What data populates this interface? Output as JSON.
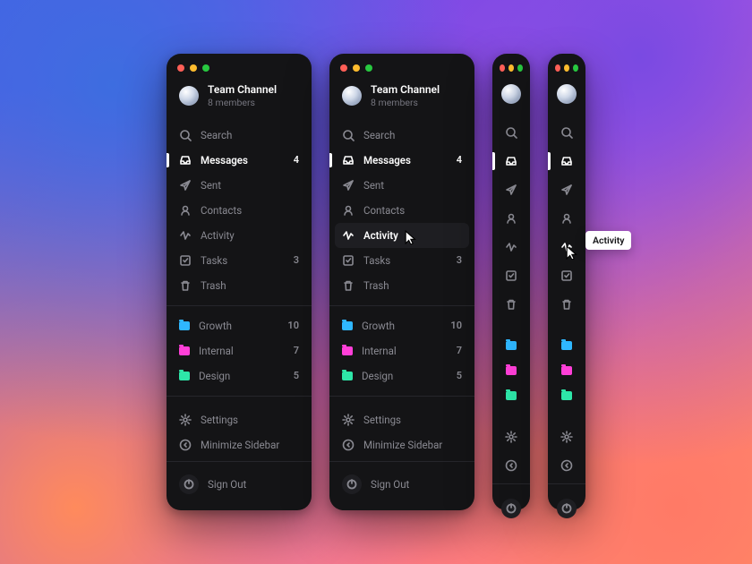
{
  "header": {
    "team_name": "Team Channel",
    "members": "8 members"
  },
  "nav": {
    "search": "Search",
    "messages": {
      "label": "Messages",
      "count": "4"
    },
    "sent": "Sent",
    "contacts": "Contacts",
    "activity": "Activity",
    "tasks": {
      "label": "Tasks",
      "count": "3"
    },
    "trash": "Trash"
  },
  "folders": {
    "growth": {
      "label": "Growth",
      "count": "10",
      "color": "#2fb7ff"
    },
    "internal": {
      "label": "Internal",
      "count": "7",
      "color": "#ff3fd8"
    },
    "design": {
      "label": "Design",
      "count": "5",
      "color": "#2ee6a8"
    }
  },
  "footer": {
    "settings": "Settings",
    "minimize": "Minimize Sidebar",
    "signout": "Sign Out"
  },
  "tooltip": {
    "activity": "Activity"
  }
}
